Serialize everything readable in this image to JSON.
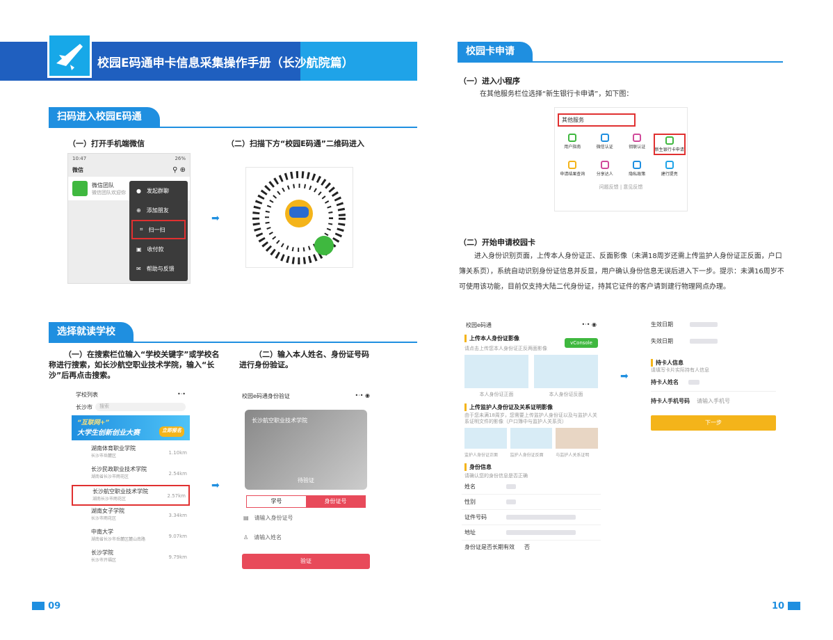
{
  "banner": {
    "title": "校园E码通申卡信息采集操作手册（长沙航院篇）"
  },
  "section1": {
    "title": "扫码进入校园E码通",
    "step1": "（一）打开手机端微信",
    "step2": "（二）扫描下方“校园E码通”二维码进入",
    "wechat": {
      "status_time": "10:47",
      "status_right": "26%",
      "app_title": "微信",
      "contact_name": "微信团队",
      "contact_sub": "微信团队欢迎你",
      "menu": [
        "发起群聊",
        "添加朋友",
        "扫一扫",
        "收付款",
        "帮助与反馈"
      ]
    }
  },
  "section2": {
    "title": "选择就读学校",
    "step1": "（一）在搜索栏位输入“学校关键字”或学校名称进行搜索，如长沙航空职业技术学院，输入“长沙”后再点击搜索。",
    "step2": "（二）输入本人姓名、身份证号码进行身份验证。",
    "school_list": {
      "title": "学校列表",
      "city": "长沙市",
      "search_placeholder": "搜索",
      "banner_line1": "“互联网+”",
      "banner_line2": "大学生创新创业大赛",
      "banner_btn": "立即报名",
      "items": [
        {
          "name": "湖南体育职业学院",
          "addr": "长沙市岳麓区",
          "dist": "1.10km"
        },
        {
          "name": "长沙民政职业技术学院",
          "addr": "湖南省长沙市雨花区",
          "dist": "2.54km"
        },
        {
          "name": "长沙航空职业技术学院",
          "addr": "湖南长沙市雨花区",
          "dist": "2.57km"
        },
        {
          "name": "湖南女子学院",
          "addr": "长沙市雨花区",
          "dist": "3.34km"
        },
        {
          "name": "中南大学",
          "addr": "湖南省长沙市岳麓区麓山南路",
          "dist": "9.07km"
        },
        {
          "name": "长沙学院",
          "addr": "长沙市开福区",
          "dist": "9.79km"
        }
      ]
    },
    "verify": {
      "title": "校园e码通身份验证",
      "card_school": "长沙航空职业技术学院",
      "card_status": "待验证",
      "tab_a": "学号",
      "tab_b": "身份证号",
      "id_placeholder": "请输入身份证号",
      "name_placeholder": "请输入姓名",
      "submit": "验证"
    }
  },
  "right": {
    "section_title": "校园卡申请",
    "step1_title": "（一）进入小程序",
    "step1_text": "在其他服务栏位选择“新生银行卡申请”，如下图：",
    "services": {
      "header": "其他服务",
      "items": [
        "用户指南",
        "微信认证",
        "钥联认证",
        "新生银行卡申请",
        "申请结果查询",
        "分享达人",
        "隐私政策",
        "建行提亮"
      ],
      "footer": "问题反馈 | 意见反馈"
    },
    "step2_title": "（二）开始申请校园卡",
    "step2_text": "进入身份识别页面，上传本人身份证正、反面影像（未满18周岁还需上传监护人身份证正反面，户口簿关系页），系统自动识别身份证信息并反显，用户确认身份信息无误后进入下一步。提示：未满16周岁不可使用该功能，目前仅支持大陆二代身份证，持其它证件的客户请到建行物理网点办理。",
    "form": {
      "title": "校园e码通",
      "vconsole": "vConsole",
      "upload_self": "上传本人身份证影像",
      "upload_self_hint": "请点击上传您本人身份证正反两面影像",
      "id_front": "本人身份证正面",
      "id_back": "本人身份证反面",
      "upload_guardian": "上传监护人身份证及关系证明影像",
      "upload_guardian_hint": "由于您未满18周岁，您需要上传监护人身份证以及与监护人关系证明文件的影像（户口簿中与监护人关系页）",
      "g_front": "监护人身份证正面",
      "g_back": "监护人身份证反面",
      "g_rel": "与监护人关系证明",
      "id_info": "身份信息",
      "id_info_hint": "请确认您的身份信息是否正确",
      "fields": [
        "姓名",
        "性别",
        "证件号码",
        "地址"
      ],
      "long_valid": "身份证是否长期有效",
      "long_valid_val": "否",
      "eff_date": "生效日期",
      "exp_date": "失效日期",
      "holder": "持卡人信息",
      "holder_hint": "请填写卡片实际持有人信息",
      "holder_name": "持卡人姓名",
      "holder_phone": "持卡人手机号码",
      "phone_placeholder": "请输入手机号",
      "next": "下一步"
    }
  },
  "footer": {
    "left": "09",
    "right": "10"
  }
}
